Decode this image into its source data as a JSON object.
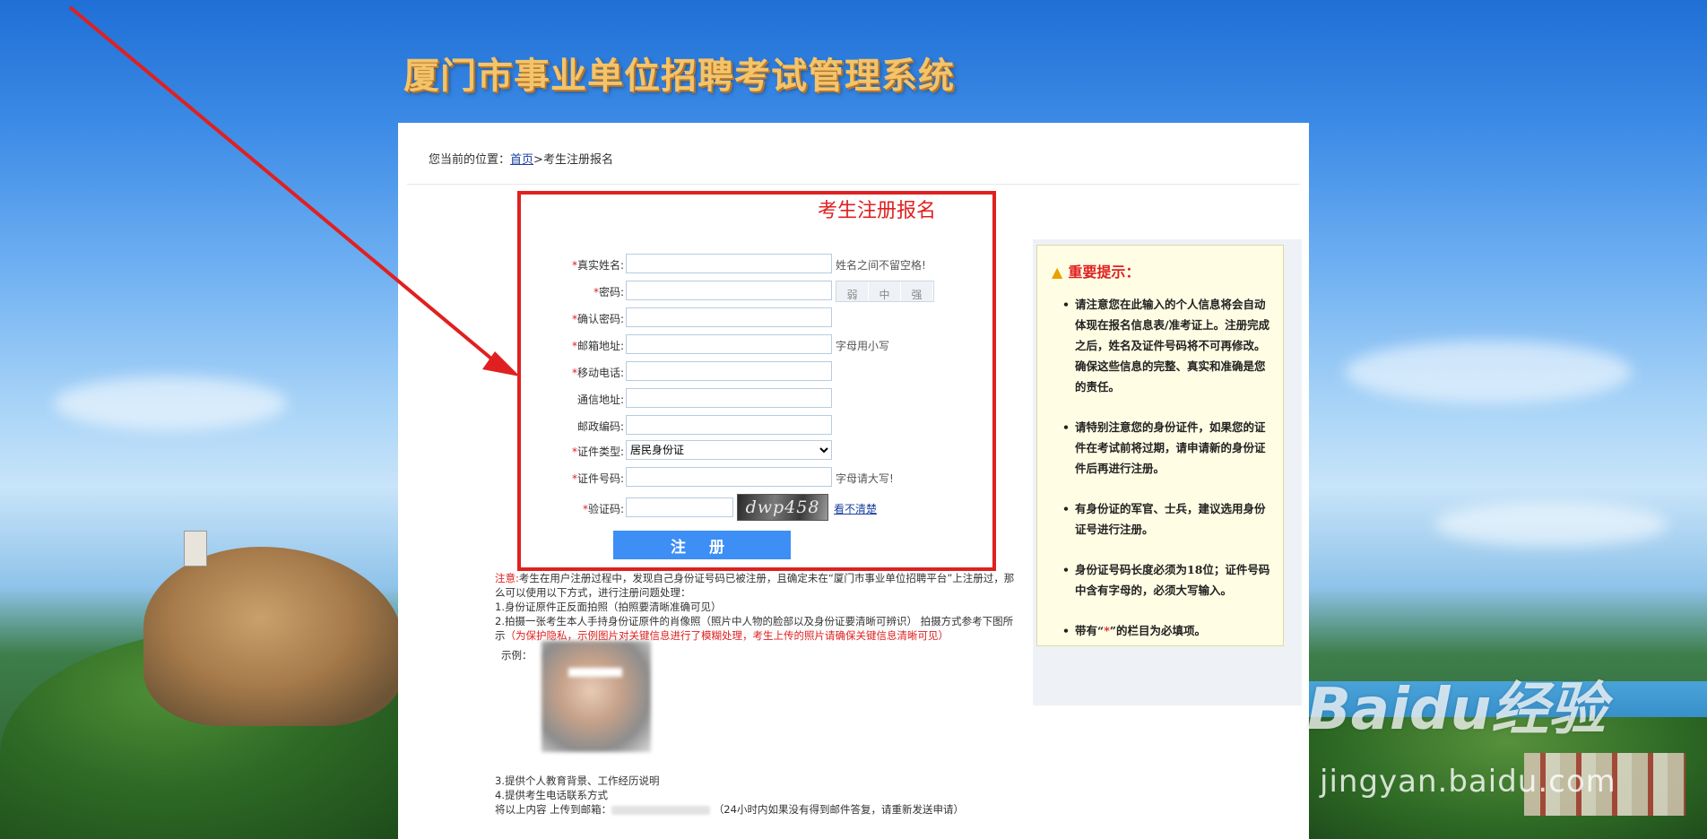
{
  "header": {
    "site_title": "厦门市事业单位招聘考试管理系统"
  },
  "breadcrumb": {
    "prefix": "您当前的位置：",
    "home": "首页",
    "separator": ">",
    "current": "考生注册报名"
  },
  "form": {
    "title": "考生注册报名",
    "required_mark": "*",
    "fields": {
      "name": {
        "label": "真实姓名:",
        "value": "",
        "hint": "姓名之间不留空格!"
      },
      "password": {
        "label": "密码:",
        "value": ""
      },
      "password_confirm": {
        "label": "确认密码:",
        "value": ""
      },
      "email": {
        "label": "邮箱地址:",
        "value": "",
        "hint": "字母用小写"
      },
      "mobile": {
        "label": "移动电话:",
        "value": ""
      },
      "address": {
        "label": "通信地址:",
        "value": ""
      },
      "postcode": {
        "label": "邮政编码:",
        "value": ""
      },
      "id_type": {
        "label": "证件类型:",
        "value": "居民身份证"
      },
      "id_number": {
        "label": "证件号码:",
        "value": "",
        "hint": "字母请大写!"
      },
      "captcha": {
        "label": "验证码:",
        "value": "",
        "image_text": "dwp458",
        "refresh": "看不清楚"
      }
    },
    "strength": {
      "weak": "弱",
      "medium": "中",
      "strong": "强"
    },
    "submit": "注 册"
  },
  "notes": {
    "label": "注意:",
    "intro": "考生在用户注册过程中，发现自己身份证号码已被注册，且确定未在“厦门市事业单位招聘平台”上注册过，那么可以使用以下方式，进行注册问题处理：",
    "item1": "1.身份证原件正反面拍照（拍照要清晰准确可见）",
    "item2": "2.拍摄一张考生本人手持身份证原件的肖像照（照片中人物的脸部以及身份证要清晰可辨识） 拍摄方式参考下图所示",
    "item2_warning": "（为保护隐私，示例图片对关键信息进行了模糊处理，考生上传的照片请确保关键信息清晰可见）",
    "example_label": "示例：",
    "item3": "3.提供个人教育背景、工作经历说明",
    "item4": "4.提供考生电话联系方式",
    "upload_prefix": "将以上内容 上传到邮箱：",
    "upload_suffix": "（24小时内如果没有得到邮件答复，请重新发送申请）"
  },
  "tips": {
    "title": "重要提示：",
    "items": [
      "请注意您在此输入的个人信息将会自动体现在报名信息表/准考证上。注册完成之后，姓名及证件号码将不可再修改。确保这些信息的完整、真实和准确是您的责任。",
      "请特别注意您的身份证件，如果您的证件在考试前将过期，请申请新的身份证件后再进行注册。",
      "有身份证的军官、士兵，建议选用身份证号进行注册。",
      "身份证号码长度必须为18位；证件号码中含有字母的，必须大写输入。"
    ],
    "last_prefix": "带有“",
    "last_mark": "*",
    "last_suffix": "”的栏目为必填项。"
  },
  "watermark": {
    "brand": "Baidu经验",
    "url": "jingyan.baidu.com"
  },
  "colors": {
    "accent_red": "#e02020",
    "button_blue": "#3d8ef5",
    "tips_bg": "#fffde4"
  }
}
